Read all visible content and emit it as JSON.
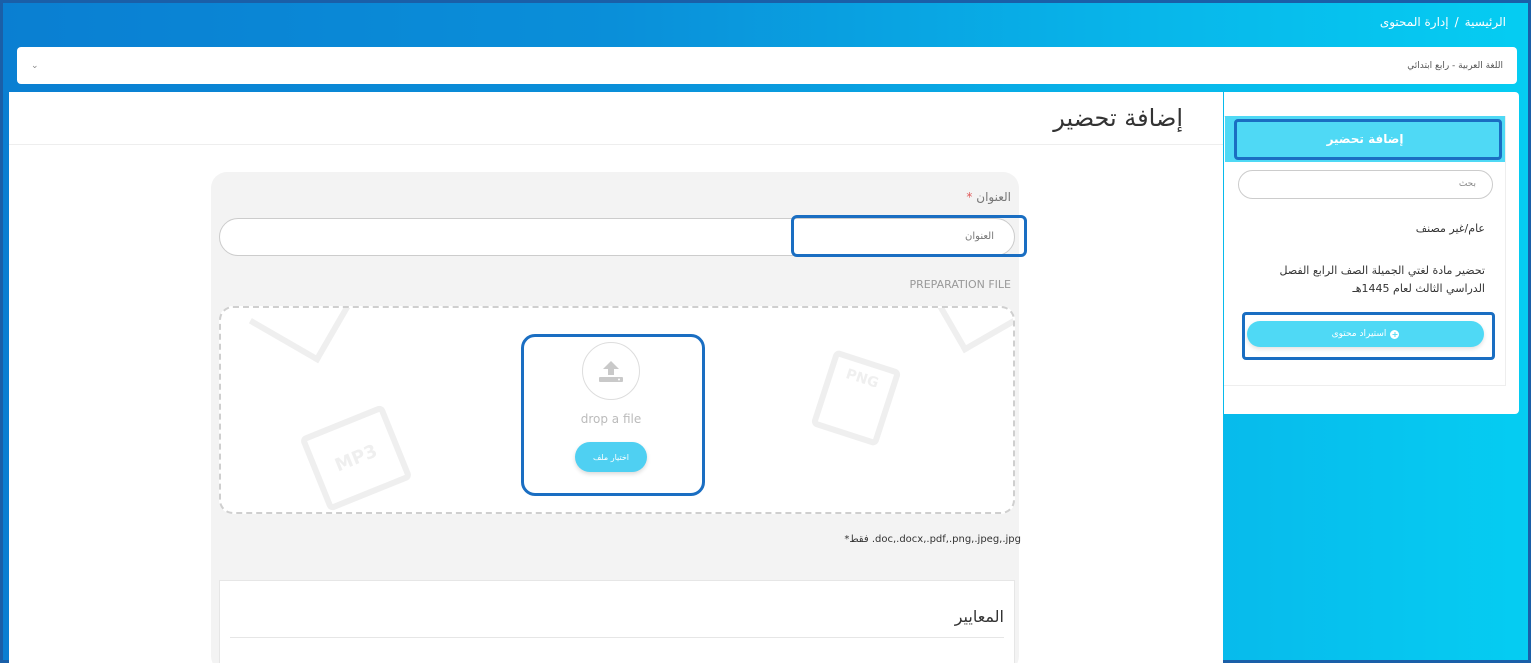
{
  "breadcrumb": {
    "home": "الرئيسية",
    "separator": "/",
    "current": "إدارة المحتوى"
  },
  "language_select": {
    "value": "اللغة العربية - رابع ابتدائي"
  },
  "main": {
    "title": "إضافة تحضير",
    "form": {
      "title_label": "العنوان",
      "required_mark": "*",
      "title_placeholder": "العنوان",
      "file_label": "PREPARATION FILE",
      "drop_text": "drop a file",
      "pick_button": "اختيار ملف",
      "decor_mp3": "MP3",
      "decor_png": "PNG",
      "allowed_formats": "*فقط .doc,.docx,.pdf,.png,.jpeg,.jpg"
    },
    "criteria": {
      "title": "المعايير"
    }
  },
  "sidebar": {
    "header": "إضافة تحضير",
    "search_placeholder": "بحث",
    "category": "عام/غير مصنف",
    "description": "تحضير مادة لغتي الجميلة الصف الرابع الفصل الدراسي الثالث لعام 1445هـ",
    "import_button": "استيراد محتوى"
  },
  "colors": {
    "accent": "#4fd9f5",
    "highlight": "#1a6ec2",
    "background_start": "#0a7fd2",
    "background_end": "#05cdf2"
  },
  "icons": [
    "chevron-down-icon",
    "upload-icon",
    "plus-circle-icon",
    "mp3-file-icon",
    "png-file-icon"
  ]
}
